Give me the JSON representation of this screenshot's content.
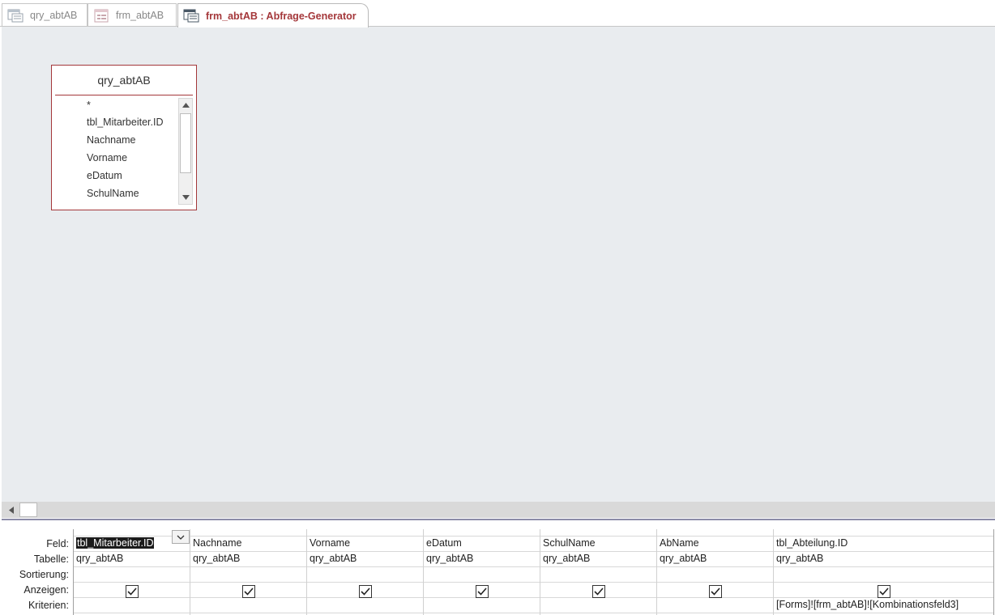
{
  "tabs": [
    {
      "label": "qry_abtAB",
      "icon": "query-icon",
      "active": false
    },
    {
      "label": "frm_abtAB",
      "icon": "form-icon",
      "active": false
    },
    {
      "label": "frm_abtAB : Abfrage-Generator",
      "icon": "query-builder-icon",
      "active": true
    }
  ],
  "field_list": {
    "title": "qry_abtAB",
    "items": [
      "*",
      "tbl_Mitarbeiter.ID",
      "Nachname",
      "Vorname",
      "eDatum",
      "SchulName"
    ]
  },
  "grid": {
    "row_labels": {
      "feld": "Feld:",
      "tabelle": "Tabelle:",
      "sortierung": "Sortierung:",
      "anzeigen": "Anzeigen:",
      "kriterien": "Kriterien:"
    },
    "columns": [
      {
        "feld": "tbl_Mitarbeiter.ID",
        "tabelle": "qry_abtAB",
        "sortierung": "",
        "anzeigen": true,
        "kriterien": ""
      },
      {
        "feld": "Nachname",
        "tabelle": "qry_abtAB",
        "sortierung": "",
        "anzeigen": true,
        "kriterien": ""
      },
      {
        "feld": "Vorname",
        "tabelle": "qry_abtAB",
        "sortierung": "",
        "anzeigen": true,
        "kriterien": ""
      },
      {
        "feld": "eDatum",
        "tabelle": "qry_abtAB",
        "sortierung": "",
        "anzeigen": true,
        "kriterien": ""
      },
      {
        "feld": "SchulName",
        "tabelle": "qry_abtAB",
        "sortierung": "",
        "anzeigen": true,
        "kriterien": ""
      },
      {
        "feld": "AbName",
        "tabelle": "qry_abtAB",
        "sortierung": "",
        "anzeigen": true,
        "kriterien": ""
      },
      {
        "feld": "tbl_Abteilung.ID",
        "tabelle": "qry_abtAB",
        "sortierung": "",
        "anzeigen": true,
        "kriterien": "[Forms]![frm_abtAB]![Kombinationsfeld3]"
      }
    ]
  },
  "colors": {
    "accent": "#a4373a",
    "pane_background": "#e9ecef"
  }
}
